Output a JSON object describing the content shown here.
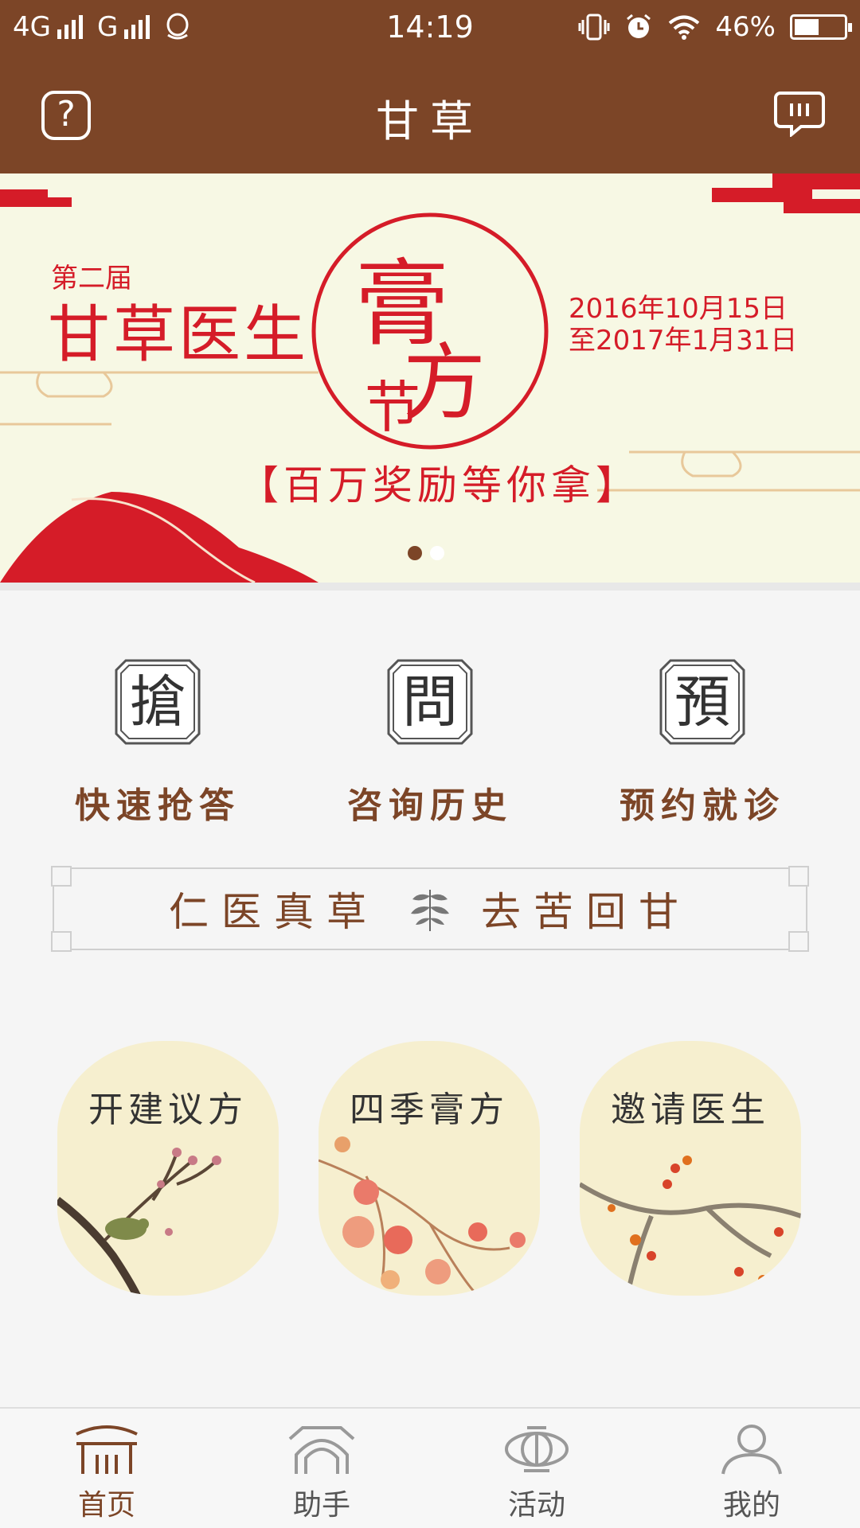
{
  "status_bar": {
    "network_left": "4G",
    "network_right": "G",
    "time": "14:19",
    "battery": "46%"
  },
  "header": {
    "title": "甘草",
    "help_symbol": "?"
  },
  "banner": {
    "edition": "第二届",
    "headline": "甘草医生",
    "seal_chars": [
      "膏",
      "方",
      "节"
    ],
    "dates": [
      "2016年10月15日",
      "至2017年1月31日"
    ],
    "reward": "【百万奖励等你拿】",
    "active_slide": 1,
    "slide_count": 2
  },
  "features": [
    {
      "icon_char": "搶",
      "label": "快速抢答",
      "icon": "qiang-seal-icon"
    },
    {
      "icon_char": "問",
      "label": "咨询历史",
      "icon": "wen-seal-icon"
    },
    {
      "icon_char": "預",
      "label": "预约就诊",
      "icon": "yu-seal-icon"
    }
  ],
  "motto": {
    "left": "仁医真草",
    "right": "去苦回甘",
    "icon": "herb-sprig-icon"
  },
  "cards": [
    {
      "label": "开建议方",
      "art": "plum-blossom-bird"
    },
    {
      "label": "四季膏方",
      "art": "autumn-leaves"
    },
    {
      "label": "邀请医生",
      "art": "winter-berries"
    }
  ],
  "bottom_nav": [
    {
      "label": "首页",
      "icon": "home-gate-icon",
      "active": true
    },
    {
      "label": "助手",
      "icon": "helper-arch-icon",
      "active": false
    },
    {
      "label": "活动",
      "icon": "activity-lantern-icon",
      "active": false
    },
    {
      "label": "我的",
      "icon": "profile-person-icon",
      "active": false
    }
  ],
  "colors": {
    "primary_brown": "#7c4527",
    "banner_red": "#d51c28",
    "banner_bg": "#f7f8e4",
    "card_bg": "#f6efcf"
  }
}
